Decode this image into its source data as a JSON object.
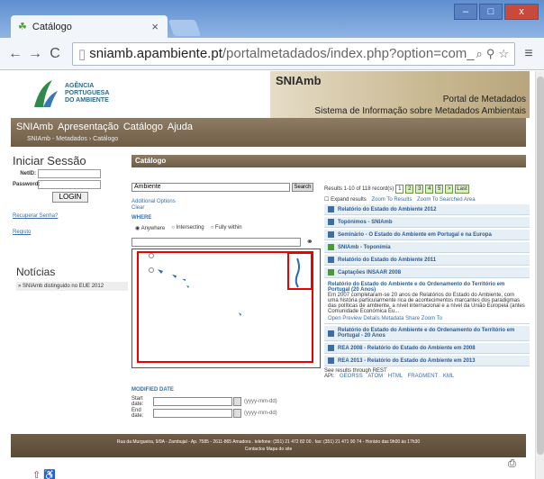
{
  "browser": {
    "tab_title": "Catálogo",
    "tab_close": "×",
    "url_domain": "sniamb.apambiente.pt",
    "url_path": "/portalmetadados/index.php?option=com_",
    "min": "–",
    "max": "□",
    "close": "x"
  },
  "header": {
    "logo_text": [
      "AGÊNCIA",
      "PORTUGUESA",
      "DO AMBIENTE"
    ],
    "banner_title": "SNIAmb",
    "banner_line1": "Portal de Metadados",
    "banner_line2": "Sistema de Informação sobre Metadados Ambientais"
  },
  "menu": {
    "items": [
      "SNIAmb",
      "Apresentação",
      "Catálogo",
      "Ajuda"
    ],
    "breadcrumb": "SNIAmb - Metadados  ›  Catálogo"
  },
  "login": {
    "heading": "Iniciar Sessão",
    "netid_label": "NetID:",
    "password_label": "Password:",
    "button": "LOGIN",
    "recover": "Recuperar Senha?",
    "register": "Registo"
  },
  "news": {
    "heading": "Notícias",
    "items": [
      "» SNIAmb distinguido no EUE 2012"
    ]
  },
  "catalog": {
    "bar_title": "Catálogo",
    "search_value": "Ambiente",
    "search_button": "Search",
    "additional_options": "Additional Options",
    "clear": "Clear",
    "where": "WHERE",
    "radios": [
      "Anywhere",
      "Intersecting",
      "Fully within"
    ],
    "modified_date": "MODIFIED DATE",
    "start_label": "Start date:",
    "end_label": "End date:",
    "date_format": "(yyyy-mm-dd)",
    "btn_dots": "..."
  },
  "results": {
    "summary": "Results 1-10 of 118 record(s)",
    "pages": [
      "1",
      "2",
      "3",
      "4",
      "5",
      ">",
      "Last"
    ],
    "expand": "Expand results",
    "zoom_results": "Zoom To Results",
    "zoom_searched": "Zoom To Searched Area",
    "items": [
      "Relatório do Estado do Ambiente 2012",
      "Topónimos - SNIAmb",
      "Seminário - O Estado do Ambiente em Portugal e na Europa",
      "SNIAmb - Toponímia",
      "Relatório do Estado do Ambiente 2011",
      "Captações INSAAR 2008"
    ],
    "expanded": {
      "title": "Relatório do Estado do Ambiente e do Ordenamento do Território em Portugal (20 Anos)",
      "desc": "Em 2007 completaram-se 20 anos de Relatórios do Estado do Ambiente, com uma história particularmente rica de acontecimentos marcantes dos paradigmas das políticas de ambiente, a nível internacional e a nível da União Europeia (antes Comunidade Económica Eu...",
      "links": [
        "Open",
        "Preview",
        "Details",
        "Metadata",
        "Share",
        "Zoom To"
      ]
    },
    "items_after": [
      "Relatório do Estado do Ambiente e do Ordenamento do Território em Portugal - 20 Anos",
      "REA 2008 - Relatório do Estado do Ambiente em 2008",
      "REA 2013 - Relatório do Estado do Ambiente em 2013"
    ],
    "see_rest": "See results through REST",
    "api_label": "API:",
    "api_links": [
      "GEORSS",
      "ATOM",
      "HTML",
      "FRAGMENT",
      "KML"
    ]
  },
  "footer": {
    "address": "Rua da Murgueira, 9/9A - Zambujal - Ap. 7585 - 2611-865 Amadora . telefone: (351) 21 472 82 00 . fax: (351) 21 471 90 74 - Horário das 9h00 às 17h30",
    "links": "Contactos  Mapa do site"
  }
}
